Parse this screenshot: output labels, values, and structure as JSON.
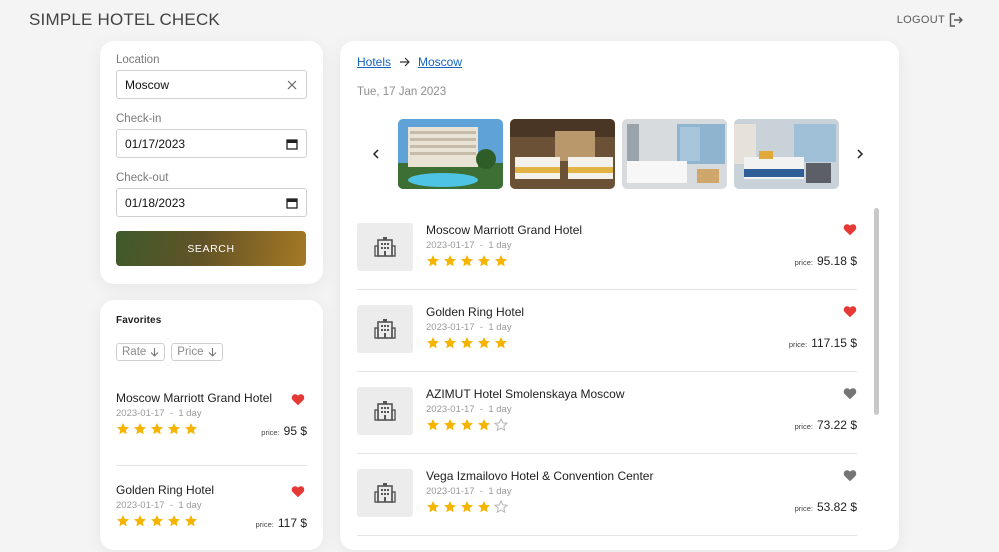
{
  "app": {
    "title": "SIMPLE HOTEL CHECK",
    "logout_label": "LOGOUT"
  },
  "search": {
    "location_label": "Location",
    "location_value": "Moscow",
    "checkin_label": "Check-in",
    "checkin_value": "01/17/2023",
    "checkout_label": "Check-out",
    "checkout_value": "01/18/2023",
    "button_label": "SEARCH"
  },
  "favorites": {
    "title": "Favorites",
    "sort": [
      {
        "label": "Rate"
      },
      {
        "label": "Price"
      }
    ],
    "items": [
      {
        "name": "Moscow Marriott Grand Hotel",
        "date": "2023-01-17",
        "sep": "-",
        "duration": "1 day",
        "rating": 5,
        "price_label": "price:",
        "price": "95 $",
        "favorite": true
      },
      {
        "name": "Golden Ring Hotel",
        "date": "2023-01-17",
        "sep": "-",
        "duration": "1 day",
        "rating": 5,
        "price_label": "price:",
        "price": "117 $",
        "favorite": true
      }
    ]
  },
  "main": {
    "breadcrumb": [
      {
        "label": "Hotels"
      },
      {
        "label": "Moscow"
      }
    ],
    "date": "Tue, 17 Jan 2023",
    "carousel": {
      "prev": "<",
      "next": ">",
      "photos": [
        "pool-resort",
        "twin-bedroom",
        "white-bedroom",
        "blue-bedroom"
      ]
    },
    "hotels": [
      {
        "name": "Moscow Marriott Grand Hotel",
        "date": "2023-01-17",
        "sep": "-",
        "duration": "1 day",
        "rating": 5,
        "price_label": "price:",
        "price": "95.18 $",
        "favorite": true
      },
      {
        "name": "Golden Ring Hotel",
        "date": "2023-01-17",
        "sep": "-",
        "duration": "1 day",
        "rating": 5,
        "price_label": "price:",
        "price": "117.15 $",
        "favorite": true
      },
      {
        "name": "AZIMUT Hotel Smolenskaya Moscow",
        "date": "2023-01-17",
        "sep": "-",
        "duration": "1 day",
        "rating": 4,
        "price_label": "price:",
        "price": "73.22 $",
        "favorite": false
      },
      {
        "name": "Vega Izmailovo Hotel & Convention Center",
        "date": "2023-01-17",
        "sep": "-",
        "duration": "1 day",
        "rating": 4,
        "price_label": "price:",
        "price": "53.82 $",
        "favorite": false
      }
    ]
  },
  "colors": {
    "accent_start": "#3f5a2a",
    "accent_end": "#a47a25",
    "heart_active": "#e53935",
    "heart_inactive": "#757575",
    "star_filled": "#f5b400",
    "star_empty": "#b5b5b5",
    "link": "#1565c0"
  },
  "icons": {
    "logout": "logout-icon",
    "clear": "close-icon",
    "calendar": "calendar-icon",
    "sort": "arrow-down-icon",
    "heart": "heart-icon",
    "star": "star-icon",
    "hotel": "building-icon",
    "crumb": "arrow-right-icon"
  }
}
